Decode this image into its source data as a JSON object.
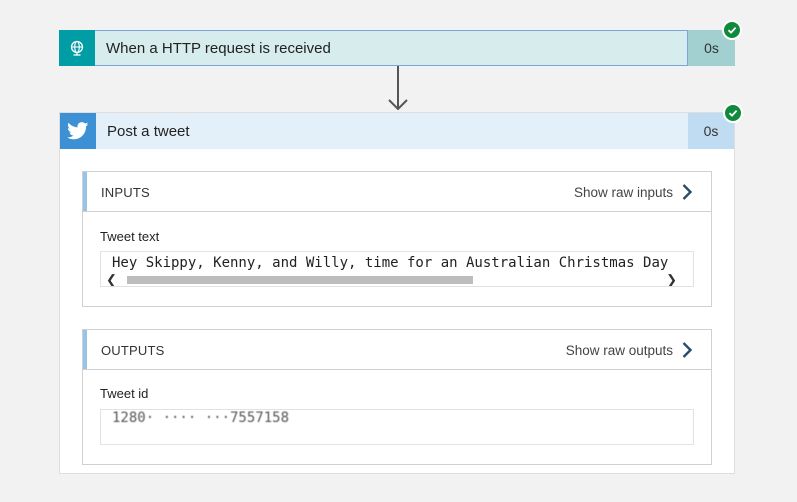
{
  "trigger": {
    "title": "When a HTTP request is received",
    "duration": "0s",
    "icon": "globe-icon",
    "status": "succeeded"
  },
  "action": {
    "title": "Post a tweet",
    "duration": "0s",
    "icon": "twitter-bird-icon",
    "status": "succeeded",
    "inputs": {
      "heading": "INPUTS",
      "raw_link": "Show raw inputs",
      "field_label": "Tweet text",
      "field_value": "Hey Skippy, Kenny, and Willy, time for an Australian Christmas Day"
    },
    "outputs": {
      "heading": "OUTPUTS",
      "raw_link": "Show raw outputs",
      "field_label": "Tweet id",
      "field_value": "1280· ···· ···7557158"
    }
  },
  "colors": {
    "trigger_accent": "#009da5",
    "twitter_accent": "#3d90d3",
    "success_green": "#0f8a3c"
  }
}
